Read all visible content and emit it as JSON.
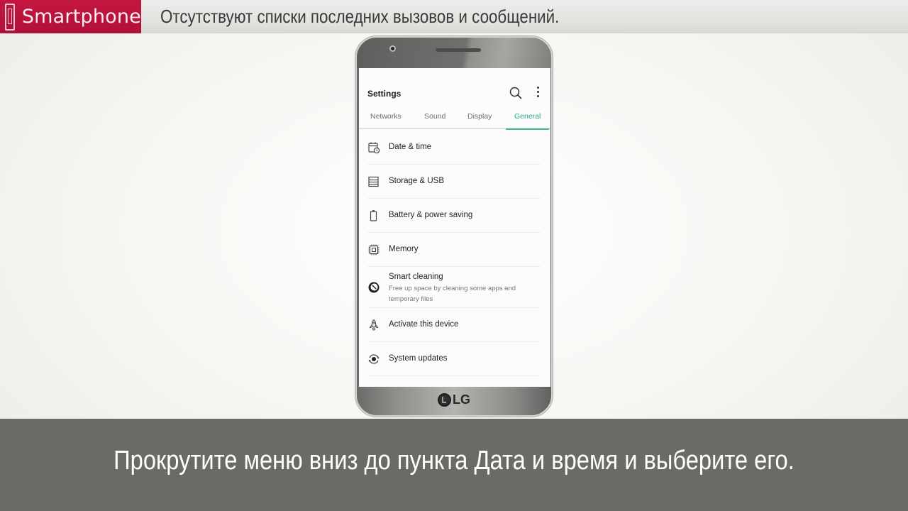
{
  "banner": {
    "brand_label": "Smartphone",
    "brand_icon": "smartphone-icon",
    "caption": "Отсутствуют списки последних вызовов и сообщений.",
    "brand_color": "#b8123c"
  },
  "phone": {
    "brand_logo": "LG"
  },
  "settings": {
    "title": "Settings",
    "actions": [
      "search-icon",
      "more-vert-icon"
    ],
    "tabs": [
      {
        "label": "Networks",
        "active": false
      },
      {
        "label": "Sound",
        "active": false
      },
      {
        "label": "Display",
        "active": false
      },
      {
        "label": "General",
        "active": true
      }
    ],
    "accent_color": "#26a892",
    "items": [
      {
        "label": "Date & time",
        "icon": "calendar-clock-icon"
      },
      {
        "label": "Storage & USB",
        "icon": "storage-icon"
      },
      {
        "label": "Battery & power saving",
        "icon": "battery-icon"
      },
      {
        "label": "Memory",
        "icon": "memory-chip-icon"
      },
      {
        "label": "Smart cleaning",
        "subtitle": "Free up space by cleaning some apps and temporary files",
        "icon": "smart-cleaning-icon"
      },
      {
        "label": "Activate this device",
        "icon": "rocket-icon"
      },
      {
        "label": "System updates",
        "icon": "system-update-icon"
      }
    ]
  },
  "instruction": {
    "text": "Прокрутите меню вниз до пункта Дата и время и выберите его."
  }
}
